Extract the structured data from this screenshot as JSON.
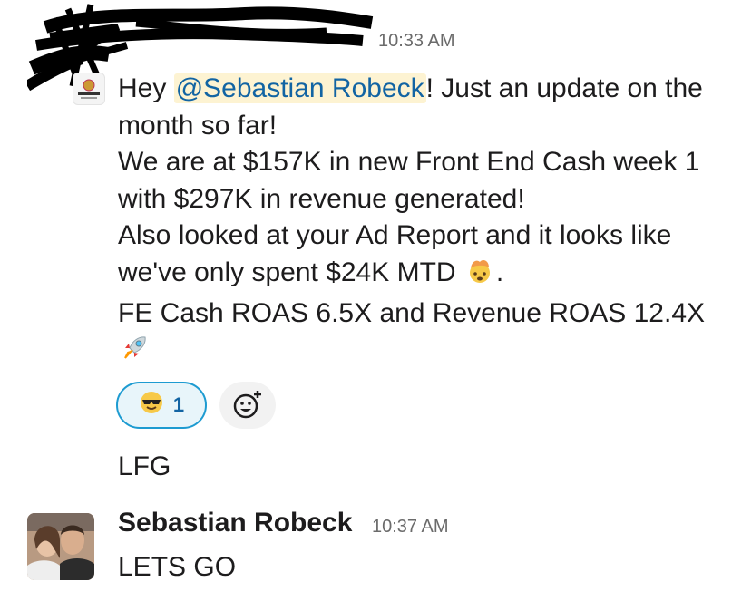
{
  "message1": {
    "time": "10:33 AM",
    "mention": "@Sebastian Robeck",
    "line1_pre": "Hey ",
    "line1_post": "! Just an update on the month so far!",
    "line2": "We are at $157K in new Front End Cash week 1 with $297K in revenue generated!",
    "line3_pre": "Also looked at your Ad Report and it looks like we've only spent $24K MTD",
    "line3_post": ".",
    "line4_pre": "FE Cash ROAS 6.5X and Revenue ROAS 12.4X",
    "reactions": [
      {
        "emoji": "sunglasses-face",
        "count": "1"
      }
    ],
    "add_reaction_icon": "add-reaction-icon"
  },
  "message2": {
    "text": "LFG"
  },
  "message3": {
    "sender": "Sebastian Robeck",
    "time": "10:37 AM",
    "text": "LETS GO"
  },
  "colors": {
    "mention_bg": "#fdf3d2",
    "mention_text": "#1264a3",
    "reaction_border": "#1d9bd1",
    "reaction_bg": "#e8f5fa"
  }
}
